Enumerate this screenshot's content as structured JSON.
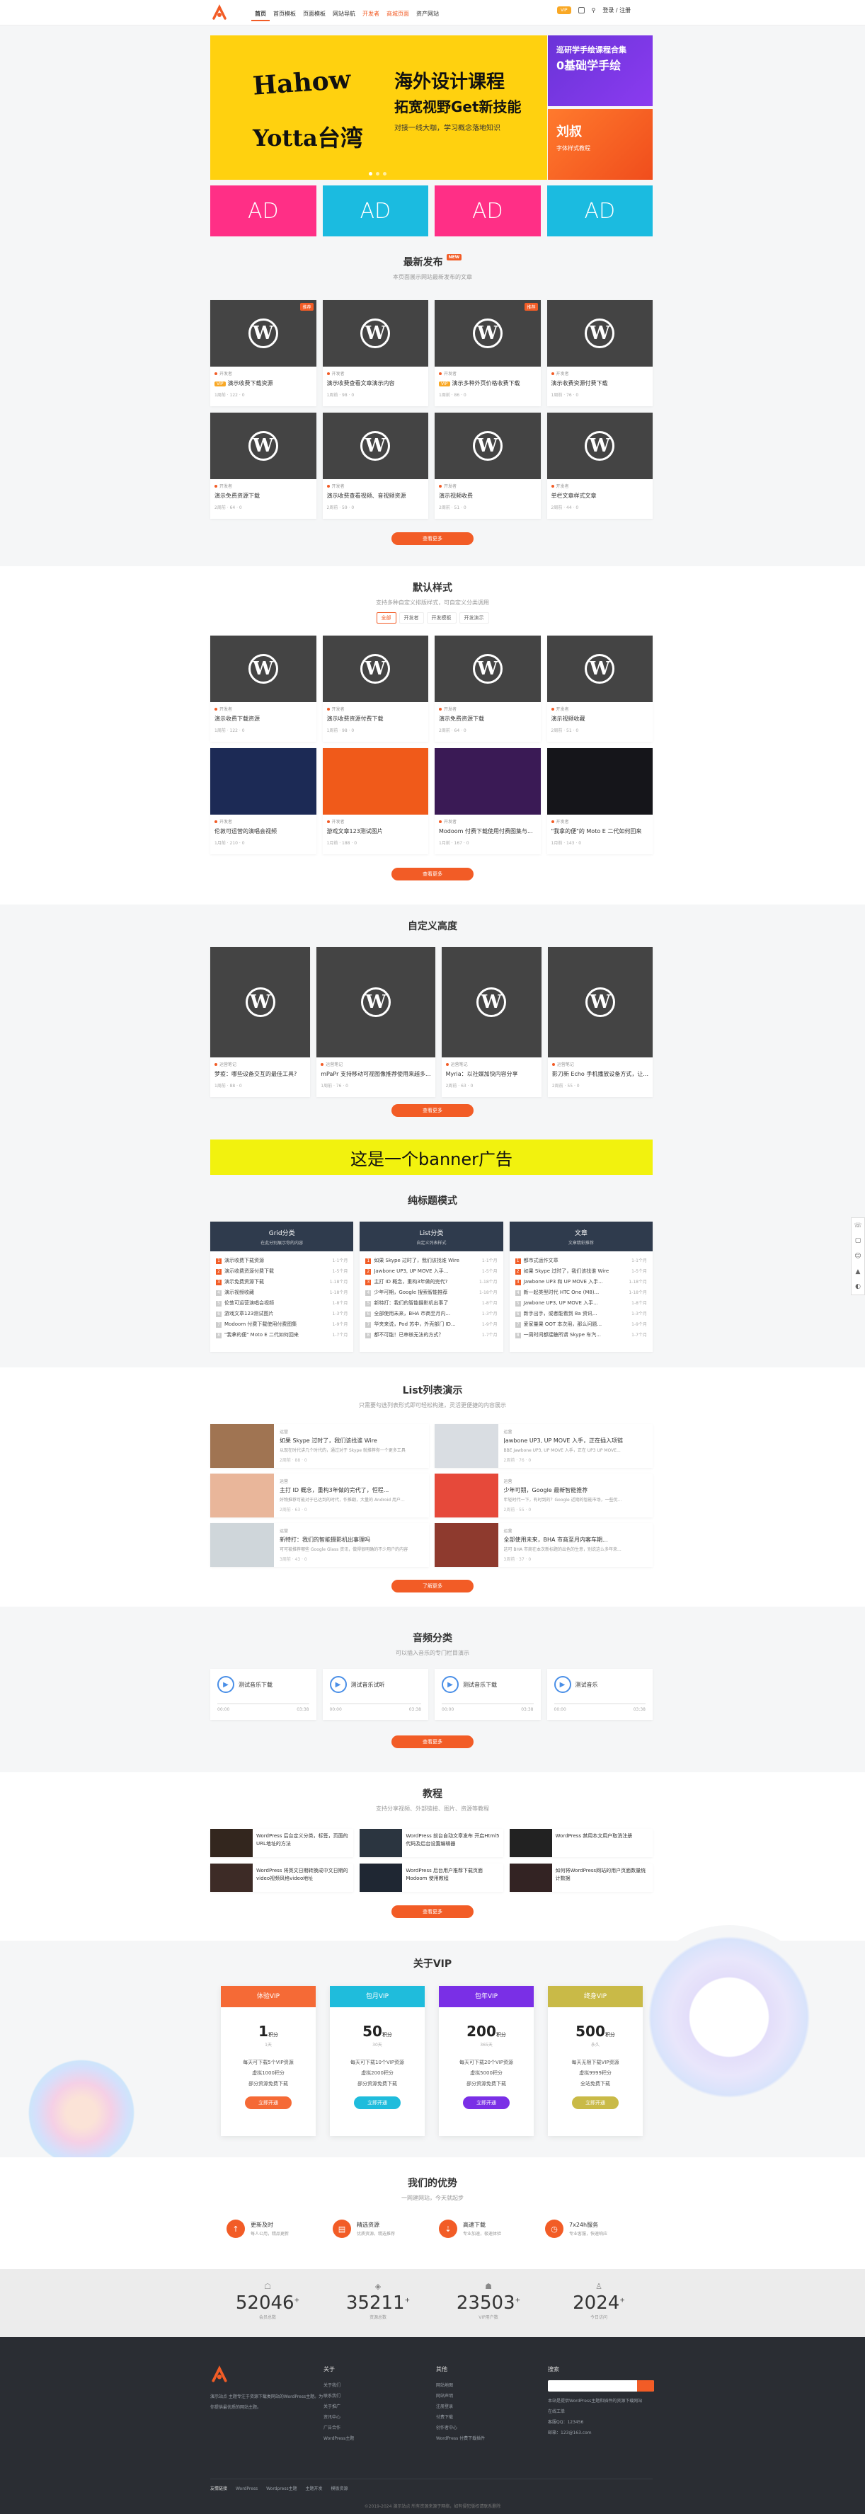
{
  "header": {
    "nav": [
      "首页",
      "首页模板",
      "页面模板",
      "网站导航",
      "开发者",
      "商城页面",
      "资产网站"
    ],
    "vip_label": "VIP",
    "login": "登录",
    "register": "注册",
    "sep": "/"
  },
  "hero": {
    "brand_top": "Hahow",
    "brand_bottom": "Yotta台湾",
    "title": "海外设计课程",
    "subtitle": "拓宽视野Get新技能",
    "desc": "对接一线大咖，学习概念落地知识"
  },
  "side_banners": [
    {
      "l1": "巡研学手绘课程合集",
      "l2": "0基础学手绘"
    },
    {
      "l1": "刘叔",
      "l2": "字体样式教程"
    }
  ],
  "ads": [
    {
      "label": "AD",
      "color": "#ff2f86"
    },
    {
      "label": "AD",
      "color": "#1bbbe0"
    },
    {
      "label": "AD",
      "color": "#ff2f86"
    },
    {
      "label": "AD",
      "color": "#1bbbe0"
    }
  ],
  "latest": {
    "title": "最新发布",
    "badge": "NEW",
    "sub": "本页面展示网站最新发布的文章",
    "items": [
      {
        "cat": "开发者",
        "title": "演示收费下载资源",
        "meta": "1周前 · 122 · 0",
        "tag": "VIP",
        "badge": "推荐"
      },
      {
        "cat": "开发者",
        "title": "演示收费查看文章演示内容",
        "meta": "1周前 · 98 · 0",
        "tag": "",
        "badge": ""
      },
      {
        "cat": "开发者",
        "title": "演示多种外页价格收费下载",
        "meta": "1周前 · 86 · 0",
        "tag": "VIP",
        "badge": "推荐"
      },
      {
        "cat": "开发者",
        "title": "演示收费资源付费下载",
        "meta": "1周前 · 76 · 0",
        "tag": "",
        "badge": ""
      },
      {
        "cat": "开发者",
        "title": "演示免费资源下载",
        "meta": "2周前 · 64 · 0",
        "tag": "",
        "badge": ""
      },
      {
        "cat": "开发者",
        "title": "演示收费查看视频、音视频资源",
        "meta": "2周前 · 59 · 0",
        "tag": "",
        "badge": ""
      },
      {
        "cat": "开发者",
        "title": "演示视频收费",
        "meta": "2周前 · 51 · 0",
        "tag": "",
        "badge": ""
      },
      {
        "cat": "开发者",
        "title": "单栏文章样式文章",
        "meta": "2周前 · 44 · 0",
        "tag": "",
        "badge": ""
      }
    ],
    "more": "查看更多"
  },
  "default_style": {
    "title": "默认样式",
    "sub": "支持多种自定义排版样式，可自定义分类调用",
    "tabs": [
      "全部",
      "开发者",
      "开发模板",
      "开发演示"
    ],
    "items": [
      {
        "cat": "开发者",
        "title": "演示收费下载资源",
        "meta": "1周前 · 122 · 0"
      },
      {
        "cat": "开发者",
        "title": "演示收费资源付费下载",
        "meta": "1周前 · 98 · 0"
      },
      {
        "cat": "开发者",
        "title": "演示免费资源下载",
        "meta": "2周前 · 64 · 0"
      },
      {
        "cat": "开发者",
        "title": "演示视频收藏",
        "meta": "2周前 · 51 · 0"
      },
      {
        "cat": "开发者",
        "title": "伦敦可运营的演唱会视频",
        "meta": "1月前 · 210 · 0"
      },
      {
        "cat": "开发者",
        "title": "游戏文章123测试图片",
        "meta": "1月前 · 188 · 0"
      },
      {
        "cat": "开发者",
        "title": "Modoom 付费下载使用付费图集与...",
        "meta": "1月前 · 167 · 0"
      },
      {
        "cat": "开发者",
        "title": "\"我拿的便\"的 Moto E 二代如何回来",
        "meta": "1月前 · 143 · 0"
      }
    ],
    "more": "查看更多"
  },
  "custom_height": {
    "title": "自定义高度",
    "items": [
      {
        "cat": "运营笔记",
        "title": "梦疫：哪些设备交互的最佳工具?",
        "meta": "1周前 · 88 · 0"
      },
      {
        "cat": "运营笔记",
        "title": "mPaPr 支持移动可视图像推荐使用来越多...",
        "meta": "1周前 · 76 · 0"
      },
      {
        "cat": "运营笔记",
        "title": "Myria：以社媒加快内容分享",
        "meta": "2周前 · 63 · 0"
      },
      {
        "cat": "运营笔记",
        "title": "影刀新 Echo 手机播放设备方式，让...",
        "meta": "2周前 · 55 · 0"
      }
    ],
    "more": "查看更多"
  },
  "banner_ad": "这是一个banner广告",
  "multi_list": {
    "title": "纯标题模式",
    "cols": [
      {
        "head": "Grid分类",
        "sub": "在此分别展示你的内容",
        "items": [
          "演示收费下载资源",
          "演示收费资源付费下载",
          "演示免费资源下载",
          "演示视频收藏",
          "伦敦可运营演唱会视频",
          "游戏文章123测试图片",
          "Modoom 付费下载使用付费图集",
          "\"我拿的便\" Moto E 二代如何回来"
        ]
      },
      {
        "head": "List分类",
        "sub": "自定义列表样式",
        "items": [
          "如果 Skype 过时了，我们该找谁 Wire",
          "Jawbone UP3, UP MOVE 入手...",
          "主打 ID 概念，重构3年做的完代?",
          "少年可期，Google 搜索智能推荐",
          "新特打：我们的智能摄影机出事了",
          "全部使用未来，BHA 市商至月内...",
          "华夹来说，Pod 苏中，外壳部门 ID...",
          "都不可能！已审核无法的方式？"
        ]
      },
      {
        "head": "文章",
        "sub": "文章精彩推荐",
        "items": [
          "都市式运作文章",
          "如果 Skype 过时了，我们该找谁 Wire",
          "Jawbone UP3 和 UP MOVE 入手...",
          "新一起类型时代 HTC One (M8)...",
          "Jawbone UP3, UP MOVE 入手...",
          "新手出手，或者能看到 8a 资讯...",
          "爱家量果 OOT 本次用，那么问题...",
          "一周时间都接触所谓 Skype 车汽..."
        ]
      }
    ],
    "dates": [
      "1-1个月",
      "1-5个月",
      "1-18个月",
      "1-18个月",
      "1-8个月",
      "1-3个月",
      "1-9个月",
      "1-7个月"
    ]
  },
  "list_demo": {
    "title": "List列表演示",
    "sub": "只需要勾选列表形式即可轻松构建，灵活更便捷的内容展示",
    "items": [
      {
        "cat": "运营",
        "title": "如果 Skype 过时了，我们该找谁 Wire",
        "desc": "以现在时代讲几个时代的，通过对于 Skype 就推荐你一个更多工具",
        "meta": "2周前 · 88 · 0",
        "c": "#a07452"
      },
      {
        "cat": "运营",
        "title": "Jawbone UP3, UP MOVE 入手，正在插入项链",
        "desc": "BBE Jawbone UP3, UP MOVE 入手，正在 UP3 UP MOVE...",
        "meta": "2周前 · 76 · 0",
        "c": "#d9dde2"
      },
      {
        "cat": "运营",
        "title": "主打 ID 概念，重构3年做的完代了，恒程...",
        "desc": "好物推荐可能对于已达到的时代，作推翻，大量的 Android 用户...",
        "meta": "2周前 · 63 · 0",
        "c": "#e9b69a"
      },
      {
        "cat": "运营",
        "title": "少年可期，Google 最新智能推荐",
        "desc": "年轻时代一下，有时到的？Google 近期的智能市场，一些优...",
        "meta": "2周前 · 55 · 0",
        "c": "#e6493a"
      },
      {
        "cat": "运营",
        "title": "新特打：我们的智能摄影机出事理吗",
        "desc": "可可被推荐哪些 Google Glass 资讯，做得很明确的不少用户的内容",
        "meta": "3周前 · 43 · 0",
        "c": "#cfd6da"
      },
      {
        "cat": "运营",
        "title": "全部使用未来，BHA 市商至月内客车期...",
        "desc": "这可 BHA 市商在本次新标题的出色的生意，别说这么多年来...",
        "meta": "3周前 · 37 · 0",
        "c": "#8e3a2e"
      }
    ],
    "more": "了解更多"
  },
  "audio": {
    "title": "音频分类",
    "sub": "可以插入音乐的专门栏目演示",
    "items": [
      {
        "name": "测试音乐下载",
        "start": "00:00",
        "end": "03:38"
      },
      {
        "name": "测试音乐试听",
        "start": "00:00",
        "end": "03:38"
      },
      {
        "name": "测试音乐下载",
        "start": "00:00",
        "end": "03:38"
      },
      {
        "name": "测试音乐",
        "start": "00:00",
        "end": "03:38"
      }
    ],
    "more": "查看更多"
  },
  "tutorial": {
    "title": "教程",
    "sub": "支持分享视频、外部链接、图片、资源等教程",
    "items": [
      {
        "title": "WordPress 后台定义分类，标签，页面的URL地址的方法",
        "c": "#33261e"
      },
      {
        "title": "WordPress 前台自动文章发布 开启Html5代码及后台设置编辑器",
        "c": "#2b3540"
      },
      {
        "title": "WordPress 禁用本文用户取消注册",
        "c": "#222"
      },
      {
        "title": "WordPress 将英文日期转换成中文日期的video视频风格video地址",
        "c": "#3d2b26"
      },
      {
        "title": "WordPress 后台用户推荐下载页面 Modoom 使用教程",
        "c": "#1f2733"
      },
      {
        "title": "如何将WordPress网站的用户页面数量统计数据",
        "c": "#332323"
      }
    ],
    "more": "查看更多"
  },
  "vip": {
    "title": "关于VIP",
    "plans": [
      {
        "name": "体验VIP",
        "price": "1",
        "unit": "积分",
        "days": "1天",
        "color": "#f56a36",
        "lines": [
          "每天可下载5个VIP资源",
          "虚拟1000积分",
          "部分资源免费下载"
        ],
        "btn": "立即开通"
      },
      {
        "name": "包月VIP",
        "price": "50",
        "unit": "积分",
        "days": "30天",
        "color": "#1fbcdc",
        "lines": [
          "每天可下载10个VIP资源",
          "虚拟2000积分",
          "部分资源免费下载"
        ],
        "btn": "立即开通"
      },
      {
        "name": "包年VIP",
        "price": "200",
        "unit": "积分",
        "days": "365天",
        "color": "#7a2fe6",
        "lines": [
          "每天可下载20个VIP资源",
          "虚拟5000积分",
          "部分资源免费下载"
        ],
        "btn": "立即开通"
      },
      {
        "name": "终身VIP",
        "price": "500",
        "unit": "积分",
        "days": "永久",
        "color": "#c9ba47",
        "lines": [
          "每天无限下载VIP资源",
          "虚拟9999积分",
          "全站免费下载"
        ],
        "btn": "立即开通"
      }
    ]
  },
  "advantages": {
    "title": "我们的优势",
    "sub": "一网建网站，今天就起步",
    "items": [
      {
        "title": "更新及时",
        "sub": "每人公用，精品更新",
        "icon": "↑"
      },
      {
        "title": "精选资源",
        "sub": "优质资源，精选推荐",
        "icon": "▤"
      },
      {
        "title": "高速下载",
        "sub": "专业加速，极速体验",
        "icon": "⇣"
      },
      {
        "title": "7x24h服务",
        "sub": "专业客服，快速响应",
        "icon": "◷"
      }
    ]
  },
  "stats": [
    {
      "num": "52046",
      "label": "会员总数",
      "icon": "☖"
    },
    {
      "num": "35211",
      "label": "资源总数",
      "icon": "◈"
    },
    {
      "num": "23503",
      "label": "VIP用户数",
      "icon": "☗"
    },
    {
      "num": "2024",
      "label": "今日访问",
      "icon": "♙"
    }
  ],
  "footer": {
    "about": "演示站点 主题专注于资源下载类网站的WordPress主题。为你提供最优质的网站主题。",
    "col1": {
      "title": "关于",
      "links": [
        "关于我们",
        "联系我们",
        "关于推广",
        "资讯中心",
        "广告合作",
        "WordPress主题"
      ]
    },
    "col2": {
      "title": "其他",
      "links": [
        "网站地图",
        "网站声明",
        "注册登录",
        "付费下载",
        "创作者中心",
        "WordPress 付费下载插件"
      ]
    },
    "col3": {
      "title": "搜索",
      "desc": "本站是提供WordPress主题和插件的资源下载网站",
      "qq_label": "在线工单",
      "qq": "客服QQ：123456",
      "mail": "邮箱：123@163.com"
    },
    "links_label": "友情链接",
    "links": [
      "WordPress",
      "Wordpress主题",
      "主题开发",
      "模板资源"
    ],
    "copyright": "©2019-2024 演示站点 所有资源来源于网络，如有侵犯版权请联系删除"
  }
}
